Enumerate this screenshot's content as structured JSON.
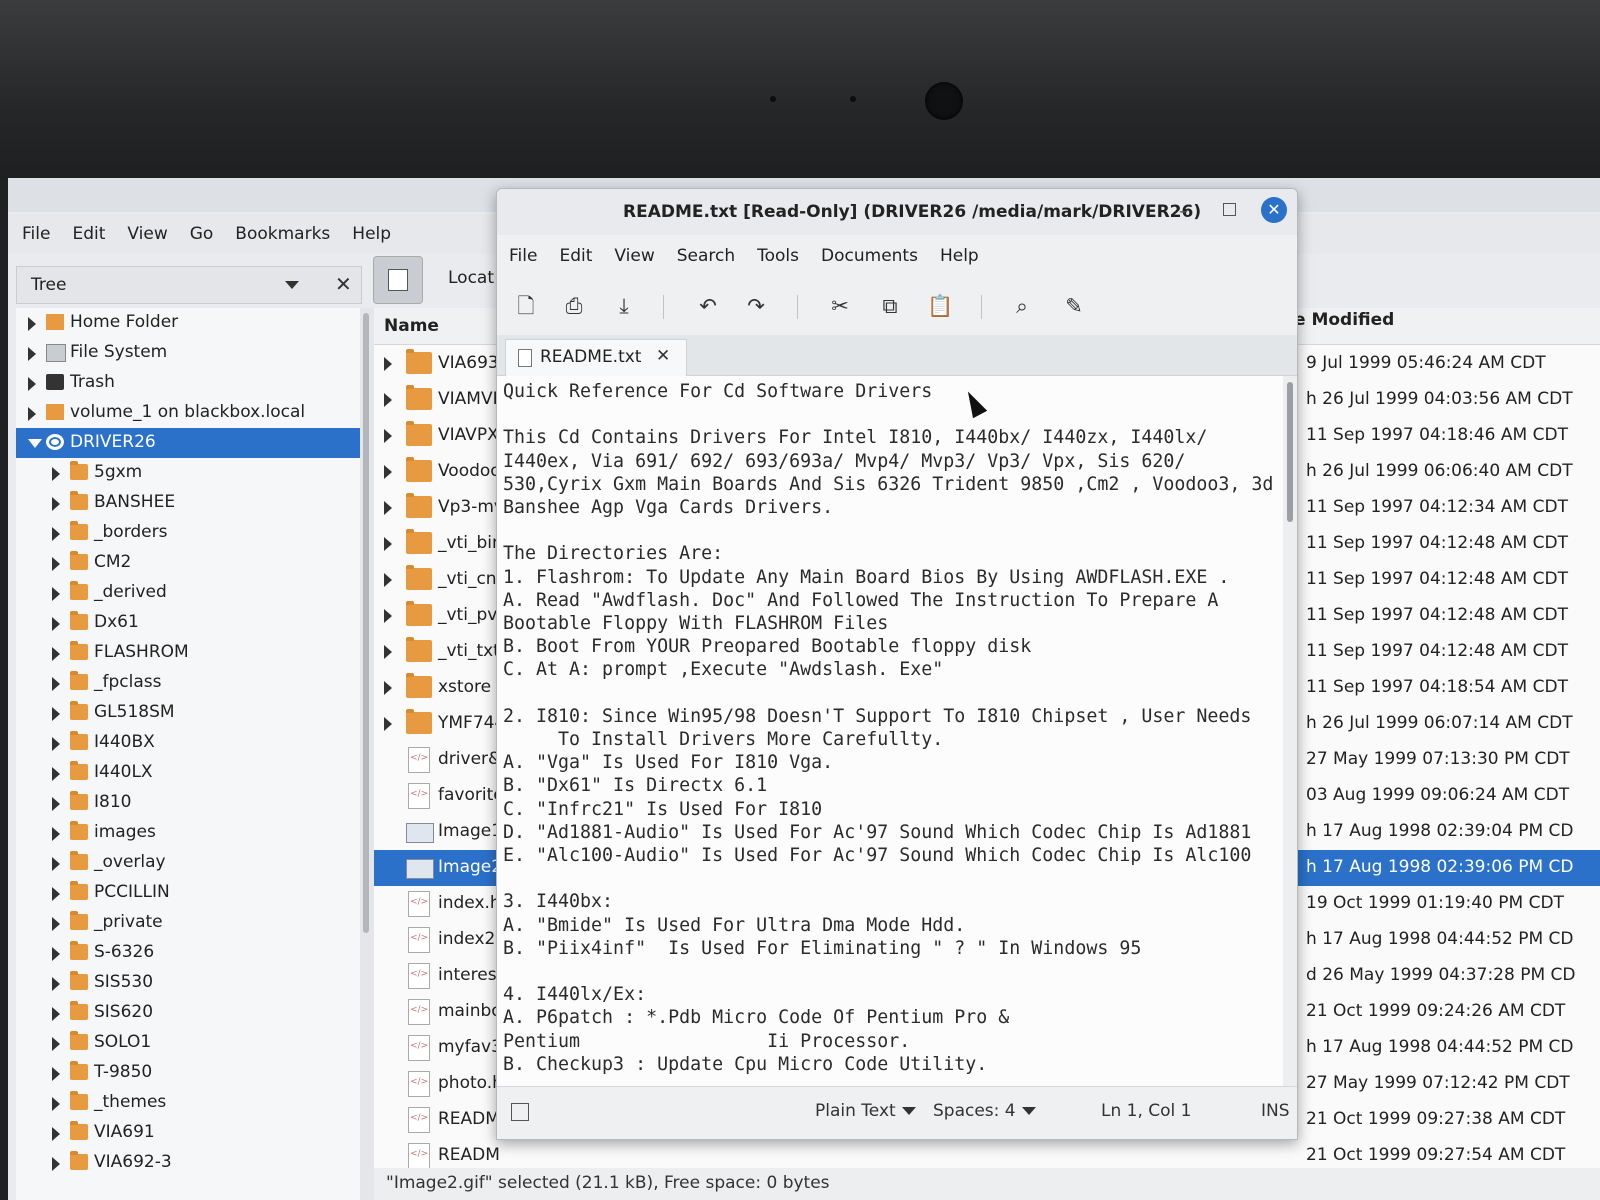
{
  "bezel": {
    "label": "DRIVER26"
  },
  "file_manager": {
    "title": "DRIVER26",
    "menu": [
      "File",
      "Edit",
      "View",
      "Go",
      "Bookmarks",
      "Help"
    ],
    "side_pane": {
      "label": "Tree",
      "close": "✕"
    },
    "location_label": "Locat",
    "tree": [
      {
        "label": "Home Folder",
        "icon": "home-icon"
      },
      {
        "label": "File System",
        "icon": "filesystem-icon"
      },
      {
        "label": "Trash",
        "icon": "trash-icon"
      },
      {
        "label": "volume_1 on blackbox.local",
        "icon": "network-drive-icon"
      },
      {
        "label": "DRIVER26",
        "icon": "disc-icon",
        "selected": true
      },
      {
        "label": "5gxm",
        "icon": "folder-icon"
      },
      {
        "label": "BANSHEE",
        "icon": "folder-icon"
      },
      {
        "label": "_borders",
        "icon": "folder-icon"
      },
      {
        "label": "CM2",
        "icon": "folder-icon"
      },
      {
        "label": "_derived",
        "icon": "folder-icon"
      },
      {
        "label": "Dx61",
        "icon": "folder-icon"
      },
      {
        "label": "FLASHROM",
        "icon": "folder-icon"
      },
      {
        "label": "_fpclass",
        "icon": "folder-icon"
      },
      {
        "label": "GL518SM",
        "icon": "folder-icon"
      },
      {
        "label": "I440BX",
        "icon": "folder-icon"
      },
      {
        "label": "I440LX",
        "icon": "folder-icon"
      },
      {
        "label": "I810",
        "icon": "folder-icon"
      },
      {
        "label": "images",
        "icon": "folder-icon"
      },
      {
        "label": "_overlay",
        "icon": "folder-icon"
      },
      {
        "label": "PCCILLIN",
        "icon": "folder-icon"
      },
      {
        "label": "_private",
        "icon": "folder-icon"
      },
      {
        "label": "S-6326",
        "icon": "folder-icon"
      },
      {
        "label": "SIS530",
        "icon": "folder-icon"
      },
      {
        "label": "SIS620",
        "icon": "folder-icon"
      },
      {
        "label": "SOLO1",
        "icon": "folder-icon"
      },
      {
        "label": "T-9850",
        "icon": "folder-icon"
      },
      {
        "label": "_themes",
        "icon": "folder-icon"
      },
      {
        "label": "VIA691",
        "icon": "folder-icon"
      },
      {
        "label": "VIA692-3",
        "icon": "folder-icon"
      }
    ],
    "columns": {
      "name": "Name",
      "modified": "e Modified"
    },
    "files": [
      {
        "name": "VIA693/",
        "date": "9 Jul 1999 05:46:24 AM CDT",
        "type": "folder"
      },
      {
        "name": "VIAMVF",
        "date": "h 26 Jul 1999 04:03:56 AM CDT",
        "type": "folder"
      },
      {
        "name": "VIAVPX",
        "date": "11 Sep 1997 04:18:46 AM CDT",
        "type": "folder"
      },
      {
        "name": "Voodoo",
        "date": "h 26 Jul 1999 06:06:40 AM CDT",
        "type": "folder"
      },
      {
        "name": "Vp3-mv",
        "date": "11 Sep 1997 04:12:34 AM CDT",
        "type": "folder"
      },
      {
        "name": "_vti_bin",
        "date": "11 Sep 1997 04:12:48 AM CDT",
        "type": "folder"
      },
      {
        "name": "_vti_cnf",
        "date": "11 Sep 1997 04:12:48 AM CDT",
        "type": "folder"
      },
      {
        "name": "_vti_pvt",
        "date": "11 Sep 1997 04:12:48 AM CDT",
        "type": "folder"
      },
      {
        "name": "_vti_txt",
        "date": "11 Sep 1997 04:12:48 AM CDT",
        "type": "folder"
      },
      {
        "name": "xstore",
        "date": "11 Sep 1997 04:18:54 AM CDT",
        "type": "folder"
      },
      {
        "name": "YMF744",
        "date": "h 26 Jul 1999 06:07:14 AM CDT",
        "type": "folder"
      },
      {
        "name": "driver&.",
        "date": "27 May 1999 07:13:30 PM CDT",
        "type": "html"
      },
      {
        "name": "favorite",
        "date": "03 Aug 1999 09:06:24 AM CDT",
        "type": "html"
      },
      {
        "name": "Image1.",
        "date": "h 17 Aug 1998 02:39:04 PM CD",
        "type": "image"
      },
      {
        "name": "Image2.",
        "date": "h 17 Aug 1998 02:39:06 PM CD",
        "type": "image",
        "selected": true
      },
      {
        "name": "index.ht",
        "date": "19 Oct 1999 01:19:40 PM CDT",
        "type": "html"
      },
      {
        "name": "index2.h",
        "date": "h 17 Aug 1998 04:44:52 PM CD",
        "type": "html"
      },
      {
        "name": "interest",
        "date": "d 26 May 1999 04:37:28 PM CD",
        "type": "html"
      },
      {
        "name": "mainboa",
        "date": "21 Oct 1999 09:24:26 AM CDT",
        "type": "html"
      },
      {
        "name": "myfav3.",
        "date": "h 17 Aug 1998 04:44:52 PM CD",
        "type": "html"
      },
      {
        "name": "photo.h",
        "date": "27 May 1999 07:12:42 PM CDT",
        "type": "html"
      },
      {
        "name": "READM",
        "date": "21 Oct 1999 09:27:38 AM CDT",
        "type": "doc"
      },
      {
        "name": "READM",
        "date": "21 Oct 1999 09:27:54 AM CDT",
        "type": "doc"
      }
    ],
    "status": "\"Image2.gif\" selected (21.1 kB), Free space: 0 bytes"
  },
  "editor": {
    "title": "README.txt [Read-Only] (DRIVER26 /media/mark/DRIVER26)",
    "menu": [
      "File",
      "Edit",
      "View",
      "Search",
      "Tools",
      "Documents",
      "Help"
    ],
    "tab_label": "README.txt",
    "text": "Quick Reference For Cd Software Drivers\n\nThis Cd Contains Drivers For Intel I810, I440bx/ I440zx, I440lx/\nI440ex, Via 691/ 692/ 693/693a/ Mvp4/ Mvp3/ Vp3/ Vpx, Sis 620/\n530,Cyrix Gxm Main Boards And Sis 6326 Trident 9850 ,Cm2 , Voodoo3, 3d\nBanshee Agp Vga Cards Drivers.\n\nThe Directories Are:\n1. Flashrom: To Update Any Main Board Bios By Using AWDFLASH.EXE .\nA. Read \"Awdflash. Doc\" And Followed The Instruction To Prepare A\nBootable Floppy With FLASHROM Files\nB. Boot From YOUR Preopared Bootable floppy disk\nC. At A: prompt ,Execute \"Awdslash. Exe\"\n\n2. I810: Since Win95/98 Doesn'T Support To I810 Chipset , User Needs\n     To Install Drivers More Carefullty.\nA. \"Vga\" Is Used For I810 Vga.\nB. \"Dx61\" Is Directx 6.1\nC. \"Infrc21\" Is Used For I810\nD. \"Ad1881-Audio\" Is Used For Ac'97 Sound Which Codec Chip Is Ad1881\nE. \"Alc100-Audio\" Is Used For Ac'97 Sound Which Codec Chip Is Alc100\n\n3. I440bx:\nA. \"Bmide\" Is Used For Ultra Dma Mode Hdd.\nB. \"Piix4inf\"  Is Used For Eliminating \" ? \" In Windows 95\n\n4. I440lx/Ex:\nA. P6patch : *.Pdb Micro Code Of Pentium Pro &\nPentium                 Ii Processor.\nB. Checkup3 : Update Cpu Micro Code Utility.",
    "status": {
      "syntax": "Plain Text",
      "spaces": "Spaces: 4",
      "position": "Ln 1, Col 1",
      "mode": "INS"
    }
  },
  "colors": {
    "selection": "#2b71c9",
    "folder": "#e79a3f"
  }
}
